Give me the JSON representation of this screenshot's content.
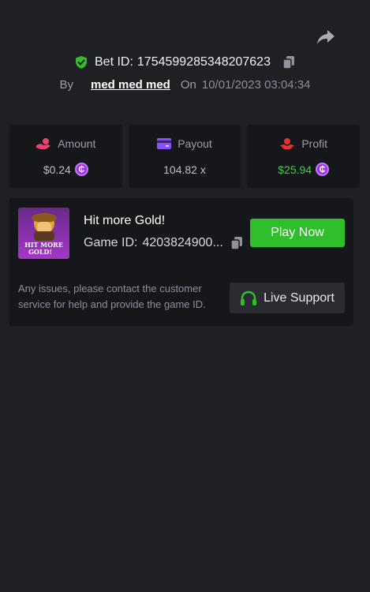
{
  "header": {
    "share_icon": "share-icon",
    "bet_label": "Bet ID:",
    "bet_id": "1754599285348207623",
    "by_label": "By",
    "username": "med med med",
    "on_label": "On",
    "datetime": "10/01/2023 03:04:34"
  },
  "stats": [
    {
      "label": "Amount",
      "value": "$0.24",
      "icon": "hand-coins-icon",
      "icon_color": "#e8456b",
      "has_coin": true
    },
    {
      "label": "Payout",
      "value": "104.82 x",
      "icon": "card-icon",
      "icon_color": "#8a4fff",
      "has_coin": false
    },
    {
      "label": "Profit",
      "value": "$25.94",
      "icon": "hand-money-icon",
      "icon_color": "#e0352e",
      "has_coin": true
    }
  ],
  "coin_symbol": "₵",
  "game": {
    "title": "Hit more Gold!",
    "id_label": "Game ID:",
    "id_value": "4203824900...",
    "thumb_text_1": "HIT MORE",
    "thumb_text_2": "GOLD!",
    "play_label": "Play Now",
    "help_text": "Any issues, please contact the customer service for help and provide the game ID.",
    "support_label": "Live Support"
  },
  "colors": {
    "accent_green": "#2fbf2d",
    "profit_green": "#37d43a",
    "background": "#1f2024",
    "panel": "#16171a"
  }
}
